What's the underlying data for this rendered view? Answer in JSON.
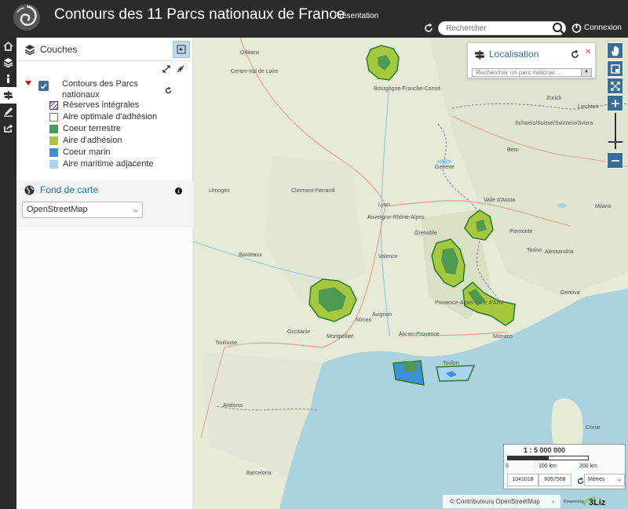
{
  "header": {
    "title": "Contours des 11 Parcs nationaux de France",
    "subtitle": "Présentation",
    "search_placeholder": "Rechercher",
    "login_label": "Connexion"
  },
  "panel": {
    "title": "Couches",
    "layer": {
      "name": "Contours des Parcs nationaux",
      "legend": [
        {
          "label": "Réserves intégrales",
          "color": "#6b2a87"
        },
        {
          "label": "Aire optimale d'adhésion",
          "color": "#3a9a4a"
        },
        {
          "label": "Coeur terrestre",
          "color": "#3f9e5e"
        },
        {
          "label": "Aire d'adhésion",
          "color": "#a6c83c"
        },
        {
          "label": "Coeur marin",
          "color": "#3d8fd4"
        },
        {
          "label": "Aire maritime adjacente",
          "color": "#a8d4f4"
        }
      ]
    },
    "basemap": {
      "title": "Fond de carte",
      "selected": "OpenStreetMap"
    }
  },
  "map": {
    "localisation": {
      "title": "Localisation",
      "placeholder": "Rechercher un parc national ..."
    },
    "scale": {
      "ratio": "1 : 5 000 000",
      "ticks": [
        "0",
        "100 km",
        "200 km"
      ]
    },
    "coordinates": {
      "x": "1041018",
      "y": "6057568"
    },
    "unit": "Mètres",
    "attribution": "© Contributeurs OpenStreetMap",
    "powered": "Powered by",
    "powered_brand": "3Liz",
    "labels": [
      {
        "text": "Orléans"
      },
      {
        "text": "Centre-Val de Loire"
      },
      {
        "text": "Bourgogne-Franche-Comté"
      },
      {
        "text": "Zurich"
      },
      {
        "text": "Liechten"
      },
      {
        "text": "Schweiz/Suisse/Svizzera/Svizra"
      },
      {
        "text": "Bern"
      },
      {
        "text": "Genève"
      },
      {
        "text": "Limoges"
      },
      {
        "text": "Clermont-Ferrand"
      },
      {
        "text": "Lyon"
      },
      {
        "text": "Auvergne-Rhône-Alpes"
      },
      {
        "text": "Grenoble"
      },
      {
        "text": "Valle d'Aosta"
      },
      {
        "text": "Piemonte"
      },
      {
        "text": "Torino"
      },
      {
        "text": "Milano"
      },
      {
        "text": "Alessandria"
      },
      {
        "text": "Genova"
      },
      {
        "text": "Valence"
      },
      {
        "text": "Bordeaux"
      },
      {
        "text": "Occitanie"
      },
      {
        "text": "Nîmes"
      },
      {
        "text": "Avignon"
      },
      {
        "text": "Montpellier"
      },
      {
        "text": "Provence-Alpes-Côte d'Azur"
      },
      {
        "text": "Aix-en-Provence"
      },
      {
        "text": "Monaco"
      },
      {
        "text": "Toulouse"
      },
      {
        "text": "Toulon"
      },
      {
        "text": "Andorra"
      },
      {
        "text": "Barcelona"
      },
      {
        "text": "Corse"
      }
    ]
  }
}
